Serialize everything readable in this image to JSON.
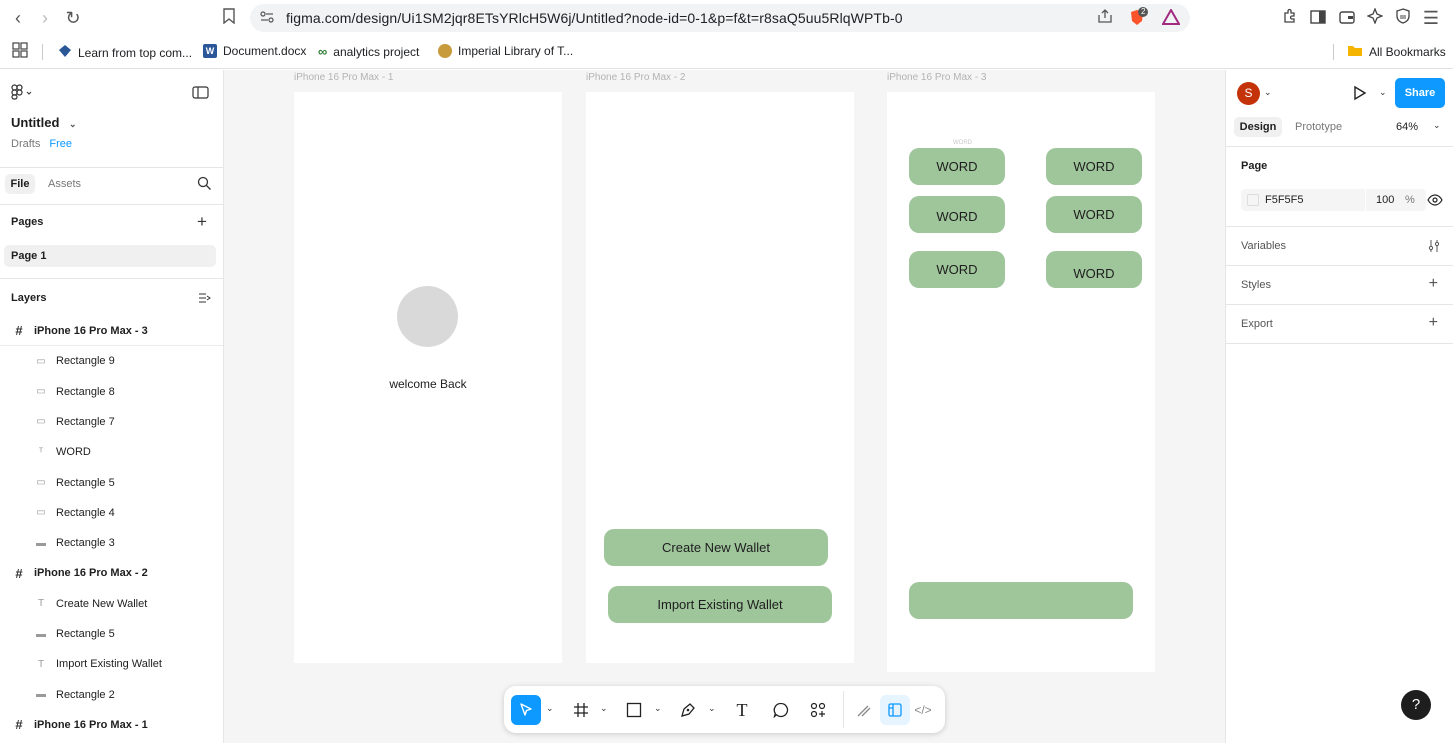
{
  "browser": {
    "url": "figma.com/design/Ui1SM2jqr8ETsYRlcH5W6j/Untitled?node-id=0-1&p=f&t=r8saQ5uu5RlqWPTb-0",
    "shield_badge": "2",
    "bookmarks": [
      {
        "label": "Learn from top com...",
        "icon": "diamond-icon",
        "color": "#2b5797"
      },
      {
        "label": "Document.docx",
        "icon": "word-icon",
        "color": "#2b579a"
      },
      {
        "label": "analytics project",
        "icon": "infinity-icon",
        "color": "#2e7d32"
      },
      {
        "label": "Imperial Library of T...",
        "icon": "book-icon",
        "color": "#c79a3b"
      }
    ],
    "all_bookmarks": "All Bookmarks"
  },
  "left": {
    "title": "Untitled",
    "drafts": "Drafts",
    "plan": "Free",
    "tab_file": "File",
    "tab_assets": "Assets",
    "pages_label": "Pages",
    "page1": "Page 1",
    "layers_label": "Layers",
    "layers": [
      {
        "label": "iPhone 16 Pro Max - 3",
        "kind": "frame"
      },
      {
        "label": "Rectangle 9",
        "kind": "rect"
      },
      {
        "label": "Rectangle 8",
        "kind": "rect"
      },
      {
        "label": "Rectangle 7",
        "kind": "rect"
      },
      {
        "label": "WORD",
        "kind": "text-small"
      },
      {
        "label": "Rectangle 5",
        "kind": "rect"
      },
      {
        "label": "Rectangle 4",
        "kind": "rect"
      },
      {
        "label": "Rectangle 3",
        "kind": "line"
      },
      {
        "label": "iPhone 16 Pro Max - 2",
        "kind": "frame"
      },
      {
        "label": "Create New Wallet",
        "kind": "text"
      },
      {
        "label": "Rectangle 5",
        "kind": "line"
      },
      {
        "label": "Import Existing Wallet",
        "kind": "text"
      },
      {
        "label": "Rectangle 2",
        "kind": "line"
      },
      {
        "label": "iPhone 16 Pro Max - 1",
        "kind": "frame"
      }
    ]
  },
  "canvas": {
    "frame1_label": "iPhone 16 Pro Max - 1",
    "frame2_label": "iPhone 16 Pro Max - 2",
    "frame3_label": "iPhone 16 Pro Max - 3",
    "welcome": "welcome Back",
    "create_wallet": "Create New Wallet",
    "import_wallet": "Import Existing Wallet",
    "word_tiny": "WORD",
    "words": [
      "WORD",
      "WORD",
      "WORD",
      "WORD",
      "WORD",
      "WORD"
    ],
    "accent_green": "#9fc59b"
  },
  "right": {
    "avatar_letter": "S",
    "avatar_color": "#c4320a",
    "share": "Share",
    "tab_design": "Design",
    "tab_prototype": "Prototype",
    "zoom": "64%",
    "page_label": "Page",
    "bg_hex": "F5F5F5",
    "bg_opacity": "100",
    "percent": "%",
    "variables": "Variables",
    "styles": "Styles",
    "export": "Export",
    "accent_blue": "#0d99ff"
  }
}
